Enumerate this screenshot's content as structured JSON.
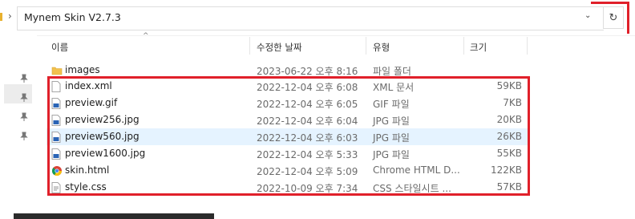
{
  "address": {
    "chevron": "›",
    "path": "Mynem Skin V2.7.3",
    "dropdown": "⌄",
    "refresh": "↻"
  },
  "columns": {
    "name": "이름",
    "modified": "수정한 날짜",
    "type": "유형",
    "size": "크기"
  },
  "files": [
    {
      "name": "images",
      "modified": "2023-06-22 오후 8:16",
      "type": "파일 폴더",
      "size": "",
      "icon": "folder-icon",
      "selected": false
    },
    {
      "name": "index.xml",
      "modified": "2022-12-04 오후 6:08",
      "type": "XML 문서",
      "size": "59KB",
      "icon": "xml-file-icon",
      "selected": false
    },
    {
      "name": "preview.gif",
      "modified": "2022-12-04 오후 6:05",
      "type": "GIF 파일",
      "size": "7KB",
      "icon": "image-file-icon",
      "selected": false
    },
    {
      "name": "preview256.jpg",
      "modified": "2022-12-04 오후 6:04",
      "type": "JPG 파일",
      "size": "20KB",
      "icon": "image-file-icon",
      "selected": false
    },
    {
      "name": "preview560.jpg",
      "modified": "2022-12-04 오후 6:03",
      "type": "JPG 파일",
      "size": "26KB",
      "icon": "image-file-icon",
      "selected": true
    },
    {
      "name": "preview1600.jpg",
      "modified": "2022-12-04 오후 5:33",
      "type": "JPG 파일",
      "size": "55KB",
      "icon": "image-file-icon",
      "selected": false
    },
    {
      "name": "skin.html",
      "modified": "2022-12-04 오후 5:09",
      "type": "Chrome HTML D...",
      "size": "122KB",
      "icon": "chrome-icon",
      "selected": false
    },
    {
      "name": "style.css",
      "modified": "2022-10-09 오후 7:34",
      "type": "CSS 스타일시트 ...",
      "size": "57KB",
      "icon": "css-file-icon",
      "selected": false
    }
  ],
  "colors": {
    "highlight": "#e0202a",
    "selection": "#e5f3ff",
    "folder": "#e8b12e"
  }
}
